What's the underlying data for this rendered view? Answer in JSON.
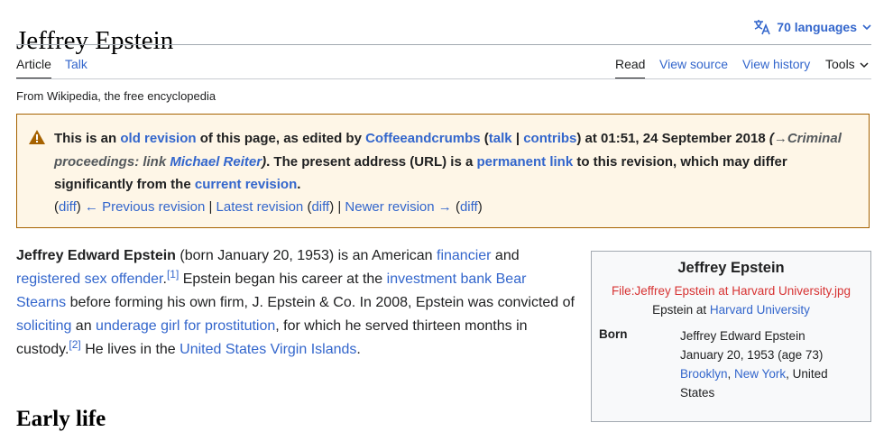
{
  "page": {
    "title": "Jeffrey Epstein",
    "languages_label": "70 languages",
    "tagline": "From Wikipedia, the free encyclopedia"
  },
  "tabs": {
    "article": "Article",
    "talk": "Talk",
    "read": "Read",
    "view_source": "View source",
    "view_history": "View history",
    "tools": "Tools"
  },
  "notice": {
    "t1": "This is an ",
    "old_revision": "old revision",
    "t2": " of this page, as edited by ",
    "user": "Coffeeandcrumbs",
    "t3": " (",
    "talk": "talk",
    "sep": " | ",
    "contribs": "contribs",
    "t4": ") at 01:51, 24 September 2018 ",
    "summary_open": "(",
    "summary_arrow": "→Criminal proceedings",
    "summary_text": ": link ",
    "summary_link": "Michael Reiter",
    "summary_close": ")",
    "t5": ". The present address (URL) is a ",
    "permanent_link": "permanent link",
    "t6": " to this revision, which may differ significantly from the ",
    "current_revision": "current revision",
    "t7": ".",
    "nav": {
      "p_open": "(",
      "diff1": "diff",
      "p_close": ")",
      "previous": "← Previous revision",
      "bar": " | ",
      "latest": "Latest revision",
      "diff2": "diff",
      "newer": "Newer revision →",
      "diff3": "diff"
    }
  },
  "lead": {
    "name": "Jeffrey Edward Epstein",
    "t1": " (born January 20, 1953) is an American ",
    "financier": "financier",
    "t2": " and ",
    "rso": "registered sex offender",
    "t3": ".",
    "ref1": "[1]",
    "t4": " Epstein began his career at the ",
    "investment_bank": "investment bank",
    "t5": " ",
    "bear_stearns": "Bear Stearns",
    "t6": " before forming his own firm, J. Epstein & Co. In 2008, Epstein was convicted of ",
    "soliciting": "soliciting",
    "t7": " an ",
    "underage": "underage girl for prostitution",
    "t8": ", for which he served thirteen months in custody.",
    "ref2": "[2]",
    "t9": " He lives in the ",
    "usvi": "United States Virgin Islands",
    "t10": "."
  },
  "section": {
    "early_life": "Early life"
  },
  "infobox": {
    "title": "Jeffrey Epstein",
    "file": "File:Jeffrey Epstein at Harvard University.jpg",
    "caption_text": "Epstein at ",
    "caption_link": "Harvard University",
    "born_label": "Born",
    "born_name": "Jeffrey Edward Epstein",
    "born_date": "January 20, 1953 (age 73)",
    "born_place_1": "Brooklyn",
    "born_comma": ", ",
    "born_place_2": "New York",
    "born_rest": ", United States"
  },
  "colors": {
    "link": "#3366cc",
    "redlink": "#d73333",
    "notice_bg": "#fef6e7",
    "notice_border": "#a66200",
    "warning_icon": "#a66200"
  },
  "icons": {
    "languages": "translate-icon",
    "chevron": "chevron-down-icon",
    "warning": "warning-triangle-icon"
  }
}
